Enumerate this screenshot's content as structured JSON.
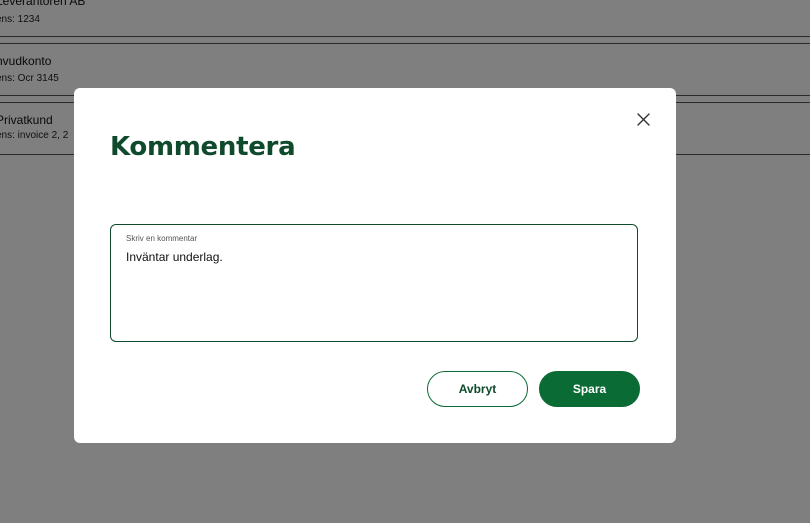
{
  "background_list": {
    "rows": [
      {
        "name": "Leverantören AB",
        "reference": "ens: 1234"
      },
      {
        "name": "nvudkonto",
        "reference": "ens: Ocr 3145"
      },
      {
        "name": "Privatkund",
        "reference": "ens: invoice 2, 2"
      }
    ]
  },
  "modal": {
    "title": "Kommentera",
    "close_icon": "close-icon",
    "comment_field": {
      "label": "Skriv en kommentar",
      "value": "Inväntar underlag."
    },
    "buttons": {
      "cancel_label": "Avbryt",
      "save_label": "Spara"
    }
  },
  "colors": {
    "brand_green": "#0b6b34",
    "title_green": "#0e4a2b",
    "overlay": "rgba(0,0,0,0.5)"
  }
}
